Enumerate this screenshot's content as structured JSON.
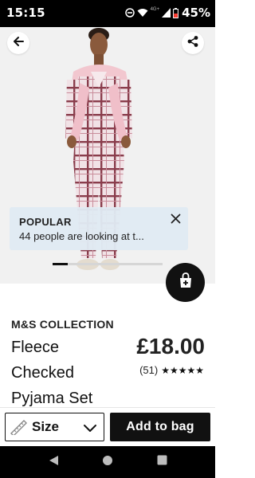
{
  "status_bar": {
    "time": "15:15",
    "network_label": "4G+",
    "battery": "45%",
    "icons": [
      "do-not-disturb-icon",
      "wifi-icon",
      "signal-icon",
      "battery-icon"
    ]
  },
  "hero": {
    "icons": {
      "back": "arrow-left-icon",
      "share": "share-icon",
      "close": "close-icon"
    },
    "carousel_progress": 0.14
  },
  "popular": {
    "title": "POPULAR",
    "text": "44 people are looking at t..."
  },
  "product": {
    "brand": "M&S COLLECTION",
    "name": "Fleece Checked Pyjama Set",
    "price": "£18.00",
    "review_count": "(51)",
    "stars": "★★★★★",
    "rating": 5
  },
  "actions": {
    "size_label": "Size",
    "add_label": "Add to bag",
    "icons": {
      "size": "ruler-icon",
      "dropdown": "chevron-down-icon",
      "bag": "shopping-bag-plus-icon"
    }
  },
  "nav": {
    "icons": [
      "back-triangle-icon",
      "home-circle-icon",
      "recents-square-icon"
    ]
  },
  "colors": {
    "primary": "#111111",
    "banner_bg": "#e0eaf2",
    "background": "#ffffff",
    "hero_bg": "#f1f1f1"
  }
}
